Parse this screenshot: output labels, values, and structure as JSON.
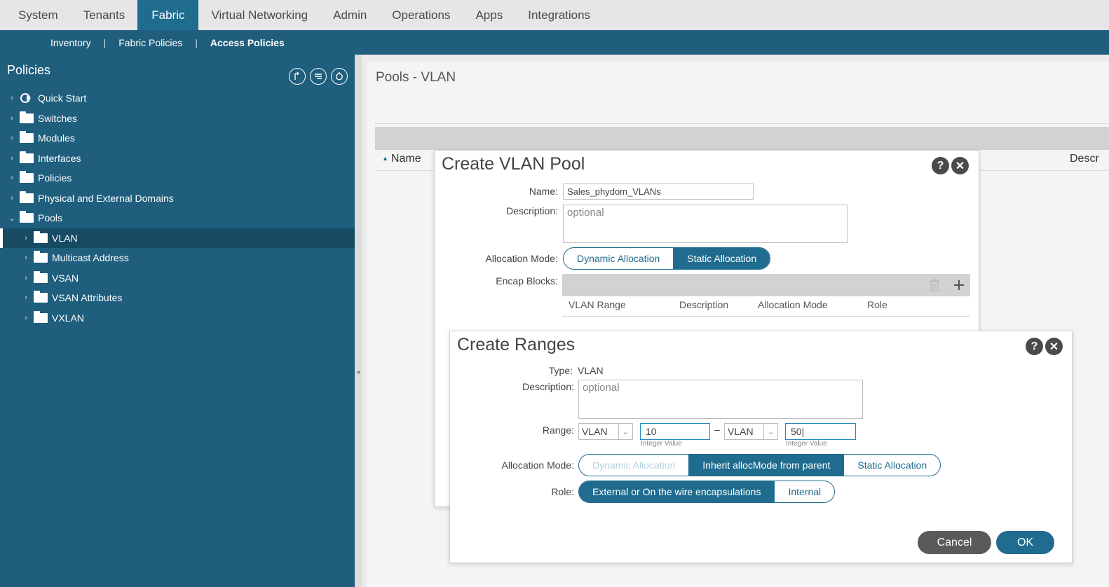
{
  "topnav": {
    "tabs": [
      "System",
      "Tenants",
      "Fabric",
      "Virtual Networking",
      "Admin",
      "Operations",
      "Apps",
      "Integrations"
    ],
    "active": "Fabric"
  },
  "subnav": {
    "items": [
      "Inventory",
      "Fabric Policies",
      "Access Policies"
    ],
    "separator": "|",
    "active": "Access Policies"
  },
  "sidebar": {
    "title": "Policies",
    "items": [
      {
        "label": "Quick Start"
      },
      {
        "label": "Switches"
      },
      {
        "label": "Modules"
      },
      {
        "label": "Interfaces"
      },
      {
        "label": "Policies"
      },
      {
        "label": "Physical and External Domains"
      },
      {
        "label": "Pools"
      },
      {
        "label": "VLAN"
      },
      {
        "label": "Multicast Address"
      },
      {
        "label": "VSAN"
      },
      {
        "label": "VSAN Attributes"
      },
      {
        "label": "VXLAN"
      }
    ]
  },
  "main": {
    "title": "Pools - VLAN",
    "col_name": "Name",
    "col_desc": "Descr"
  },
  "vlan_pool": {
    "title": "Create VLAN Pool",
    "help": "?",
    "close": "✕",
    "name_label": "Name:",
    "name_value": "Sales_phydom_VLANs",
    "desc_label": "Description:",
    "desc_placeholder": "optional",
    "alloc_label": "Allocation Mode:",
    "alloc_options": [
      "Dynamic Allocation",
      "Static Allocation"
    ],
    "alloc_selected": "Static Allocation",
    "encap_label": "Encap Blocks:",
    "encap_cols": [
      "VLAN Range",
      "Description",
      "Allocation Mode",
      "Role"
    ]
  },
  "ranges": {
    "title": "Create Ranges",
    "help": "?",
    "close": "✕",
    "type_label": "Type:",
    "type_value": "VLAN",
    "desc_label": "Description:",
    "desc_placeholder": "optional",
    "range_label": "Range:",
    "range_from_type": "VLAN",
    "range_from_value": "10",
    "range_dash": "–",
    "range_to_type": "VLAN",
    "range_to_value": "50|",
    "integer_hint": "Integer Value",
    "alloc_label": "Allocation Mode:",
    "alloc_options": [
      "Dynamic Allocation",
      "Inherit allocMode from parent",
      "Static Allocation"
    ],
    "alloc_selected": "Inherit allocMode from parent",
    "role_label": "Role:",
    "role_options": [
      "External or On the wire encapsulations",
      "Internal"
    ],
    "role_selected": "External or On the wire encapsulations",
    "cancel": "Cancel",
    "ok": "OK"
  },
  "colors": {
    "accent": "#1f6c8f",
    "sidebar": "#1f5e7d",
    "cancel": "#5a5a5a"
  }
}
